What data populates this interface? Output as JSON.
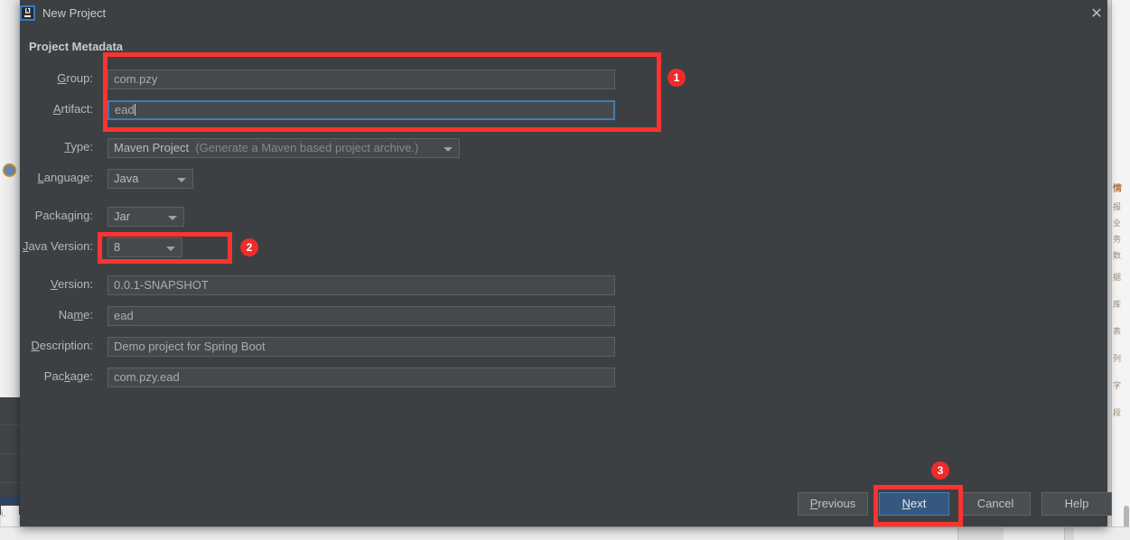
{
  "window": {
    "title": "New Project",
    "app_icon": "intellij-idea-icon",
    "close_icon": "close-icon"
  },
  "dialog": {
    "section_title": "Project Metadata",
    "fields": [
      {
        "key": "group",
        "label_pre": "",
        "label_mnemonic": "G",
        "label_post": "roup:",
        "value": "com.pzy",
        "type": "text",
        "focused": false
      },
      {
        "key": "artifact",
        "label_pre": "",
        "label_mnemonic": "A",
        "label_post": "rtifact:",
        "value": "ead",
        "type": "text",
        "focused": true
      },
      {
        "key": "type",
        "label_pre": "",
        "label_mnemonic": "T",
        "label_post": "ype:",
        "value": "Maven Project",
        "hint": "(Generate a Maven based project archive.)",
        "type": "combo"
      },
      {
        "key": "language",
        "label_pre": "",
        "label_mnemonic": "L",
        "label_post": "anguage:",
        "value": "Java",
        "type": "combo"
      },
      {
        "key": "packaging",
        "label_pre": "Packa",
        "label_mnemonic": "g",
        "label_post": "ing:",
        "value": "Jar",
        "type": "combo"
      },
      {
        "key": "javaversion",
        "label_pre": "",
        "label_mnemonic": "J",
        "label_post": "ava Version:",
        "value": "8",
        "type": "combo"
      },
      {
        "key": "version",
        "label_pre": "",
        "label_mnemonic": "V",
        "label_post": "ersion:",
        "value": "0.0.1-SNAPSHOT",
        "type": "text",
        "focused": false
      },
      {
        "key": "name",
        "label_pre": "Na",
        "label_mnemonic": "m",
        "label_post": "e:",
        "value": "ead",
        "type": "text",
        "focused": false
      },
      {
        "key": "description",
        "label_pre": "",
        "label_mnemonic": "D",
        "label_post": "escription:",
        "value": "Demo project for Spring Boot",
        "type": "text",
        "focused": false
      },
      {
        "key": "package",
        "label_pre": "Pac",
        "label_mnemonic": "k",
        "label_post": "age:",
        "value": "com.pzy.ead",
        "type": "text",
        "focused": false
      }
    ],
    "buttons": [
      {
        "key": "previous",
        "pre": "",
        "mnemonic": "P",
        "post": "revious",
        "default": false
      },
      {
        "key": "next",
        "pre": "",
        "mnemonic": "N",
        "post": "ext",
        "default": true
      },
      {
        "key": "cancel",
        "pre": "C",
        "mnemonic": "",
        "post": "ancel",
        "default": false
      },
      {
        "key": "help",
        "pre": "H",
        "mnemonic": "",
        "post": "elp",
        "default": false
      }
    ]
  },
  "annotations": {
    "color": "#fc3330",
    "badge_color": "#ef2b2b",
    "items": [
      {
        "number": "1",
        "target": "group-and-artifact-fields"
      },
      {
        "number": "2",
        "target": "java-version-combo"
      },
      {
        "number": "3",
        "target": "next-button"
      }
    ]
  },
  "background": {
    "right_fragments": [
      "情",
      "报",
      "业",
      "务",
      "数",
      "据",
      "库",
      "表",
      "列",
      "字",
      "段"
    ],
    "left_text": "i.\nte"
  }
}
